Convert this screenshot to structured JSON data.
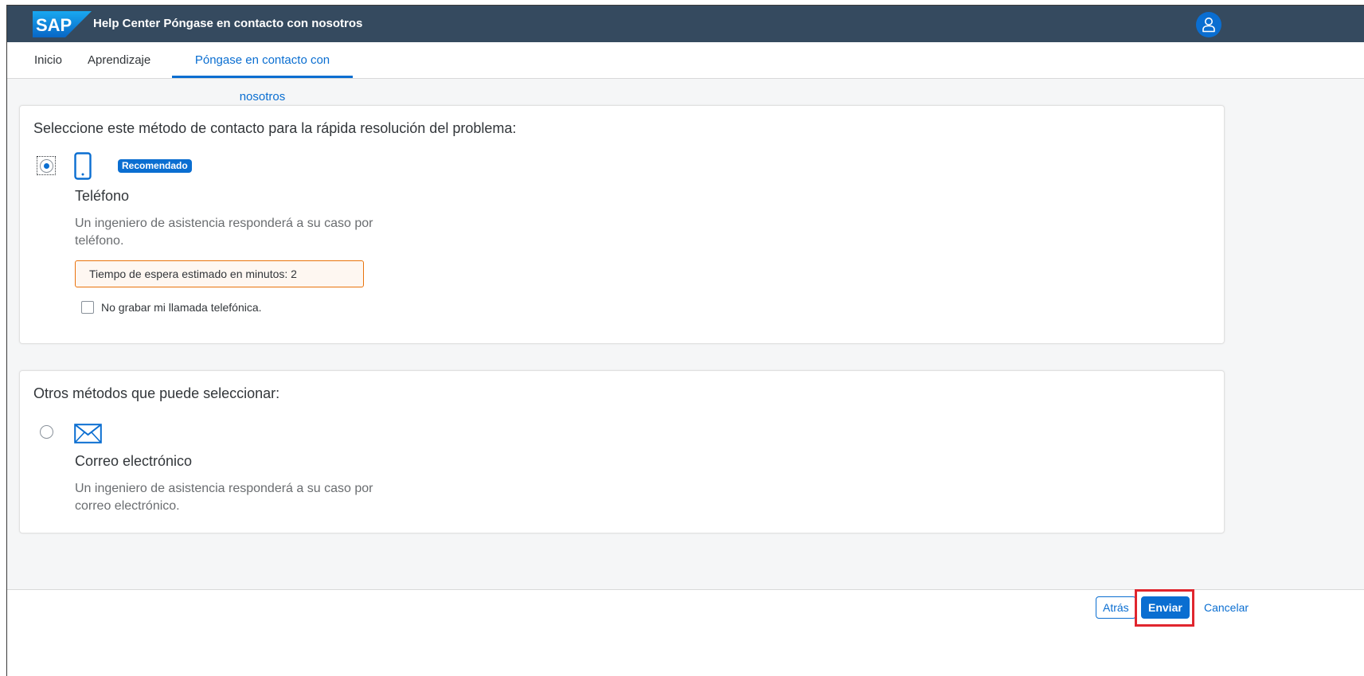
{
  "header": {
    "logo_text": "SAP",
    "title": "Help Center Póngase en contacto con nosotros",
    "avatar_icon": "user-icon"
  },
  "tabs": [
    {
      "label": "Inicio",
      "active": false
    },
    {
      "label": "Aprendizaje",
      "active": false
    },
    {
      "label": "Póngase en contacto con nosotros",
      "active": true
    }
  ],
  "recommended_section": {
    "title": "Seleccione este método de contacto para la rápida resolución del problema:",
    "method": {
      "icon": "phone-icon",
      "badge": "Recomendado",
      "name": "Teléfono",
      "description": "Un ingeniero de asistencia responderá a su caso por teléfono.",
      "selected": true,
      "wait_time_text": "Tiempo de espera estimado en minutos: 2",
      "checkbox_label": "No grabar mi llamada telefónica.",
      "checkbox_checked": false
    }
  },
  "other_section": {
    "title": "Otros métodos que puede seleccionar:",
    "method": {
      "icon": "email-icon",
      "name": "Correo electrónico",
      "description": "Un ingeniero de asistencia responderá a su caso por correo electrónico.",
      "selected": false
    }
  },
  "footer": {
    "back_label": "Atrás",
    "send_label": "Enviar",
    "cancel_label": "Cancelar"
  },
  "colors": {
    "shell": "#354a5f",
    "accent": "#0a6ed1",
    "warning": "#e9730c",
    "highlight": "#e0262e"
  }
}
